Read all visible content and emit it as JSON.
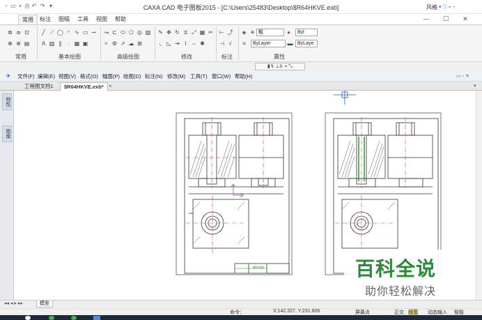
{
  "window": {
    "title": "CAXA CAD 电子图板2015 - [C:\\Users\\25483\\Desktop\\$R64HKVE.exb]",
    "style_label": "风格",
    "minimize": "—",
    "maximize": "☐",
    "close": "✕"
  },
  "ribbon": {
    "tabs": [
      "常用",
      "标注",
      "图幅",
      "工具",
      "视图",
      "帮助"
    ],
    "active_tab": "常用",
    "groups": [
      "常用",
      "基本绘图",
      "高级绘图",
      "修改",
      "标注",
      "属性"
    ],
    "layer_combo": "粗",
    "linestyle_combo": "ByLayer",
    "lineweight_combo": "ByLayer",
    "color_combo": "Byl",
    "color_combo2": "ByLaye"
  },
  "menubar": {
    "items": [
      "文件(F)",
      "编辑(E)",
      "视图(V)",
      "格式(O)",
      "幅面(P)",
      "绘图(D)",
      "标注(N)",
      "修改(M)",
      "工具(T)",
      "窗口(W)",
      "帮助(H)"
    ]
  },
  "doc_tabs": {
    "items": [
      "工程图文档1",
      "$R64HKVE.exb*"
    ],
    "active": "$R64HKVE.exb*",
    "close": "×"
  },
  "side_panel": {
    "tabs": [
      "特性",
      "图库"
    ]
  },
  "layout_bar": {
    "model_tab": "模型"
  },
  "status_bar": {
    "command_text": "命令：",
    "coords": "X:142.327, Y:231.606",
    "snap_mode": "屏幕点",
    "ortho": "正交",
    "linewidth": "线宽",
    "dynamic_input": "动态输入",
    "smart": "智能"
  },
  "drawing": {
    "title_block_text": "零件名称"
  },
  "watermark": {
    "main": "百科全说",
    "sub": "助你轻松解决"
  },
  "colors": {
    "accent": "#1e6fc8",
    "watermark_green": "#2a8a3a",
    "taskbar": "#1e2a3a"
  }
}
